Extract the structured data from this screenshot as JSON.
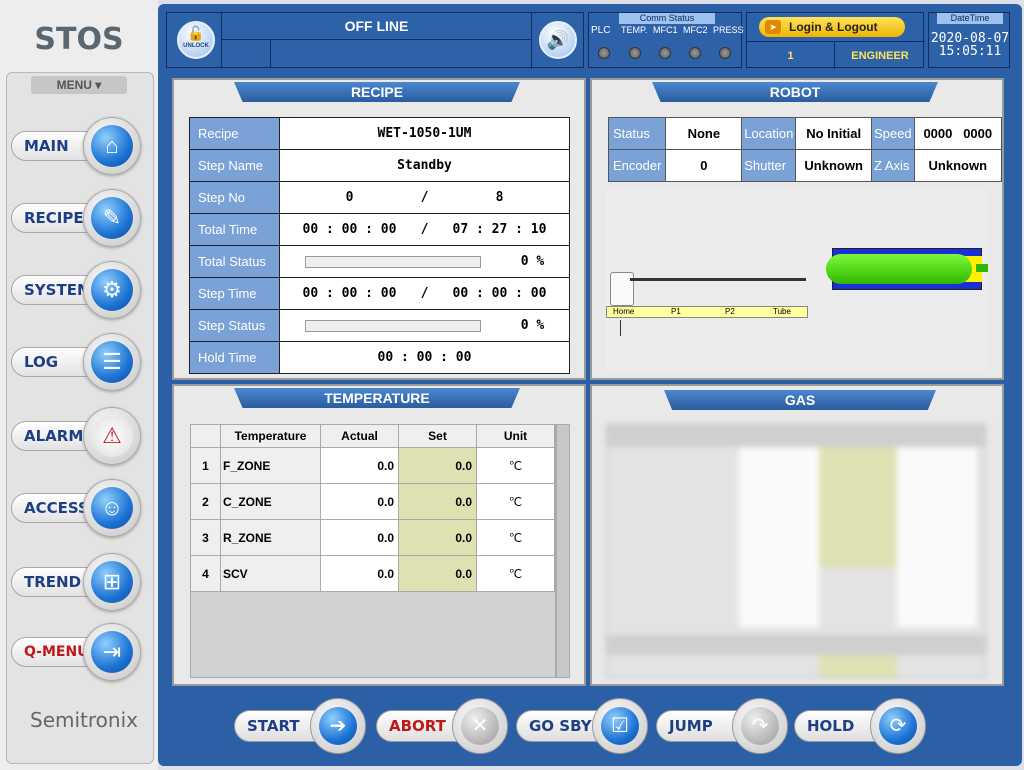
{
  "app": {
    "logo": "STOS",
    "brand": "Semitronix",
    "menu_label": "MENU ▾"
  },
  "nav": [
    {
      "id": "main",
      "label": "MAIN",
      "icon": "house-icon",
      "glyph": "⌂"
    },
    {
      "id": "recipe",
      "label": "RECIPE",
      "icon": "recipe-icon",
      "glyph": "✎"
    },
    {
      "id": "system",
      "label": "SYSTEM",
      "icon": "system-icon",
      "glyph": "⚙"
    },
    {
      "id": "log",
      "label": "LOG",
      "icon": "log-icon",
      "glyph": "☰"
    },
    {
      "id": "alarm",
      "label": "ALARM",
      "icon": "alarm-icon",
      "glyph": "⚠"
    },
    {
      "id": "access",
      "label": "ACCESS",
      "icon": "access-icon",
      "glyph": "☺"
    },
    {
      "id": "trend",
      "label": "TREND",
      "icon": "trend-icon",
      "glyph": "⊞"
    },
    {
      "id": "qmenu",
      "label": "Q-MENU",
      "icon": "qmenu-icon",
      "glyph": "⇥"
    }
  ],
  "topbar": {
    "unlock_label": "UNLOCK",
    "status": "OFF LINE"
  },
  "comm": {
    "title": "Comm Status",
    "items": [
      "PLC",
      "TEMP.",
      "MFC1",
      "MFC2",
      "PRESS"
    ]
  },
  "login": {
    "button": "Login & Logout",
    "level": "1",
    "user": "ENGINEER"
  },
  "datetime": {
    "title": "DateTime",
    "date": "2020-08-07",
    "time": "15:05:11"
  },
  "recipe": {
    "title": "RECIPE",
    "rows": [
      {
        "k": "Recipe",
        "v": "WET-1050-1UM"
      },
      {
        "k": "Step Name",
        "v": "Standby"
      },
      {
        "k": "Step No",
        "a": "0",
        "sep": "/",
        "b": "8"
      },
      {
        "k": "Total Time",
        "a": "00 : 00 : 00",
        "sep": "/",
        "b": "07 : 27 : 10"
      },
      {
        "k": "Total Status",
        "pct": "0",
        "unit": "%"
      },
      {
        "k": "Step Time",
        "a": "00 : 00 : 00",
        "sep": "/",
        "b": "00 : 00 : 00"
      },
      {
        "k": "Step Status",
        "pct": "0",
        "unit": "%"
      },
      {
        "k": "Hold Time",
        "v": "00 : 00 : 00"
      }
    ]
  },
  "robot": {
    "title": "ROBOT",
    "status_k": "Status",
    "status_v": "None",
    "location_k": "Location",
    "location_v": "No Initial",
    "speed_k": "Speed",
    "speed_v1": "0000",
    "speed_v2": "0000",
    "encoder_k": "Encoder",
    "encoder_v": "0",
    "shutter_k": "Shutter",
    "shutter_v": "Unknown",
    "zaxis_k": "Z Axis",
    "zaxis_v": "Unknown",
    "track": [
      "Home",
      "P1",
      "P2",
      "Tube"
    ]
  },
  "temperature": {
    "title": "TEMPERATURE",
    "headers": [
      "Temperature",
      "Actual",
      "Set",
      "Unit"
    ],
    "rows": [
      {
        "n": "1",
        "name": "F_ZONE",
        "actual": "0.0",
        "set": "0.0",
        "unit": "℃"
      },
      {
        "n": "2",
        "name": "C_ZONE",
        "actual": "0.0",
        "set": "0.0",
        "unit": "℃"
      },
      {
        "n": "3",
        "name": "R_ZONE",
        "actual": "0.0",
        "set": "0.0",
        "unit": "℃"
      },
      {
        "n": "4",
        "name": "SCV",
        "actual": "0.0",
        "set": "0.0",
        "unit": "℃"
      }
    ]
  },
  "gas": {
    "title": "GAS"
  },
  "actions": [
    {
      "id": "start",
      "label": "START",
      "glyph": "➔",
      "color": "#1e3f85"
    },
    {
      "id": "abort",
      "label": "ABORT",
      "glyph": "✕",
      "color": "#c01818"
    },
    {
      "id": "gosby",
      "label": "GO SBY",
      "glyph": "☑",
      "color": "#1e3f85"
    },
    {
      "id": "jump",
      "label": "JUMP",
      "glyph": "↷",
      "color": "#1e3f85"
    },
    {
      "id": "hold",
      "label": "HOLD",
      "glyph": "⟳",
      "color": "#1e3f85"
    }
  ]
}
